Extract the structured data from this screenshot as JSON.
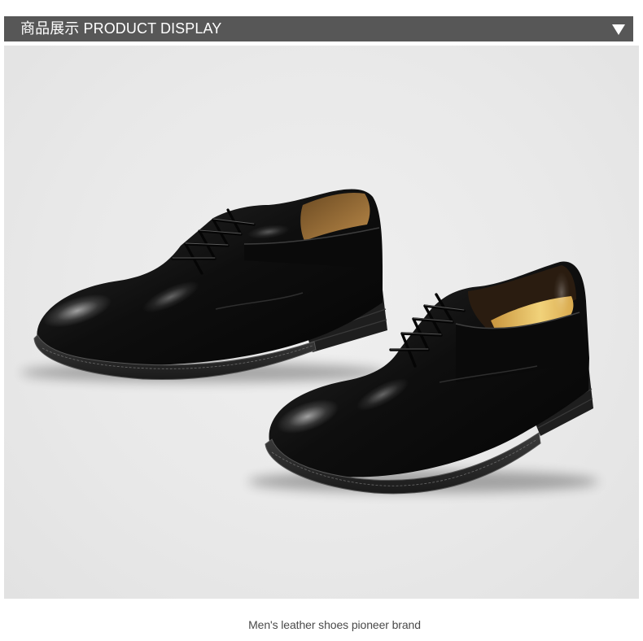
{
  "header": {
    "title": "商品展示 PRODUCT DISPLAY",
    "toggle_icon": "triangle-down-icon"
  },
  "caption": "Men's leather shoes pioneer brand",
  "colors": {
    "header_bg": "#575757",
    "header_text": "#ffffff",
    "photo_bg": "#e9e9e9",
    "caption_color": "#4a4a4a",
    "leather": "#0d0d0d",
    "insole": "#e3bd62"
  }
}
